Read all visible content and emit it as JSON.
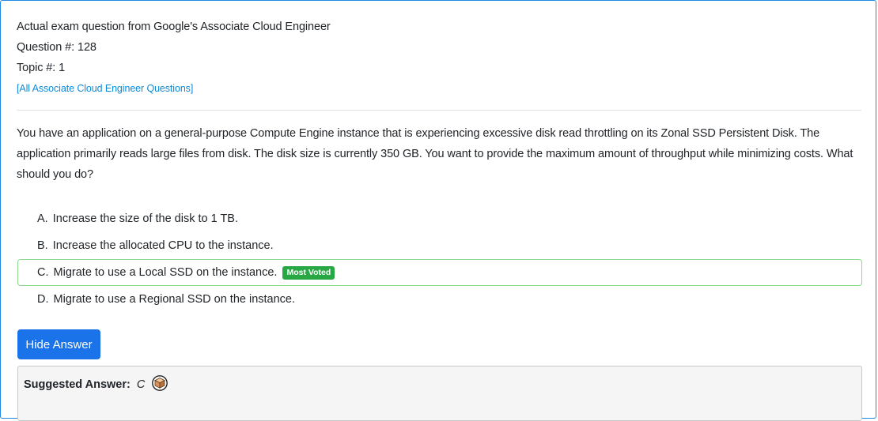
{
  "header": {
    "exam_line": "Actual exam question from Google's Associate Cloud Engineer",
    "question_number": "Question #: 128",
    "topic_number": "Topic #: 1",
    "all_questions_link": "[All Associate Cloud Engineer Questions]"
  },
  "question": {
    "text": "You have an application on a general-purpose Compute Engine instance that is experiencing excessive disk read throttling on its Zonal SSD Persistent Disk. The application primarily reads large files from disk. The disk size is currently 350 GB. You want to provide the maximum amount of throughput while minimizing costs. What should you do?"
  },
  "choices": [
    {
      "letter": "A.",
      "text": "Increase the size of the disk to 1 TB.",
      "most_voted": false
    },
    {
      "letter": "B.",
      "text": "Increase the allocated CPU to the instance.",
      "most_voted": false
    },
    {
      "letter": "C.",
      "text": "Migrate to use a Local SSD on the instance.",
      "most_voted": true
    },
    {
      "letter": "D.",
      "text": "Migrate to use a Regional SSD on the instance.",
      "most_voted": false
    }
  ],
  "badge_label": "Most Voted",
  "hide_answer_button": "Hide Answer",
  "answer": {
    "label": "Suggested Answer:",
    "value": "C",
    "icon": "community-box-icon"
  },
  "colors": {
    "card_border": "#1e88e5",
    "link": "#0d8bd6",
    "button": "#1a73e8",
    "badge": "#28a745",
    "correct_border": "#8fd98f"
  }
}
